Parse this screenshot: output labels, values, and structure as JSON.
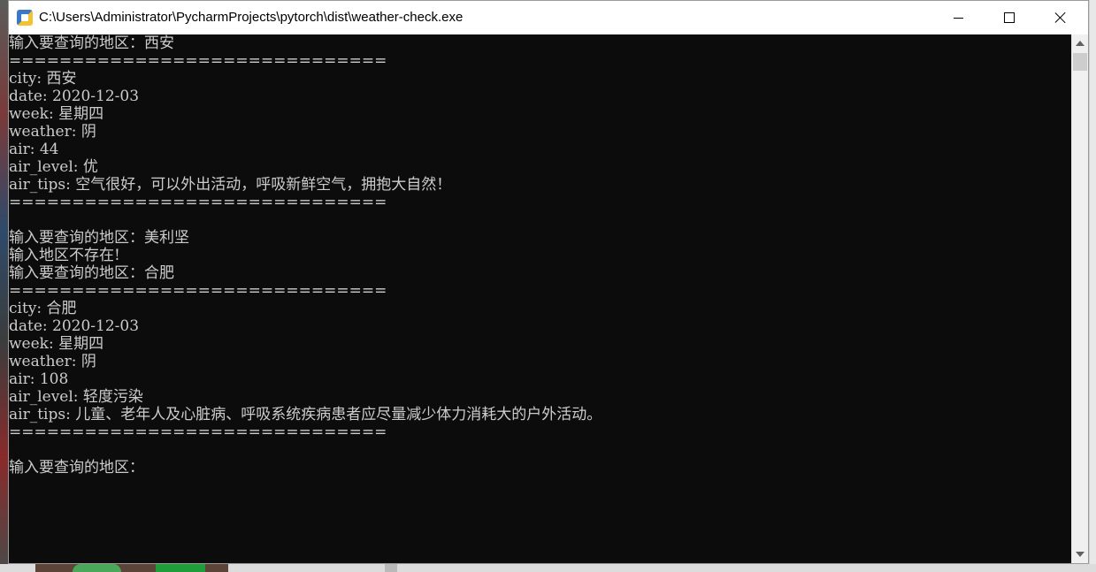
{
  "window": {
    "title": "C:\\Users\\Administrator\\PycharmProjects\\pytorch\\dist\\weather-check.exe"
  },
  "console": {
    "lines": [
      "输入要查询的地区：西安",
      "==============================",
      "city: 西安",
      "date: 2020-12-03",
      "week: 星期四",
      "weather: 阴",
      "air: 44",
      "air_level: 优",
      "air_tips: 空气很好，可以外出活动，呼吸新鲜空气，拥抱大自然！",
      "==============================",
      "",
      "输入要查询的地区：美利坚",
      "输入地区不存在!",
      "输入要查询的地区：合肥",
      "==============================",
      "city: 合肥",
      "date: 2020-12-03",
      "week: 星期四",
      "weather: 阴",
      "air: 108",
      "air_level: 轻度污染",
      "air_tips: 儿童、老年人及心脏病、呼吸系统疾病患者应尽量减少体力消耗大的户外活动。",
      "==============================",
      "",
      "输入要查询的地区："
    ]
  },
  "colors": {
    "console_bg": "#0c0c0c",
    "console_text": "#cccccc",
    "titlebar_bg": "#ffffff"
  },
  "icons": {
    "app": "python-exe-icon",
    "minimize": "minimize-icon",
    "maximize": "maximize-icon",
    "close": "close-icon",
    "scroll_up": "scroll-up-arrow-icon",
    "scroll_down": "scroll-down-arrow-icon"
  }
}
